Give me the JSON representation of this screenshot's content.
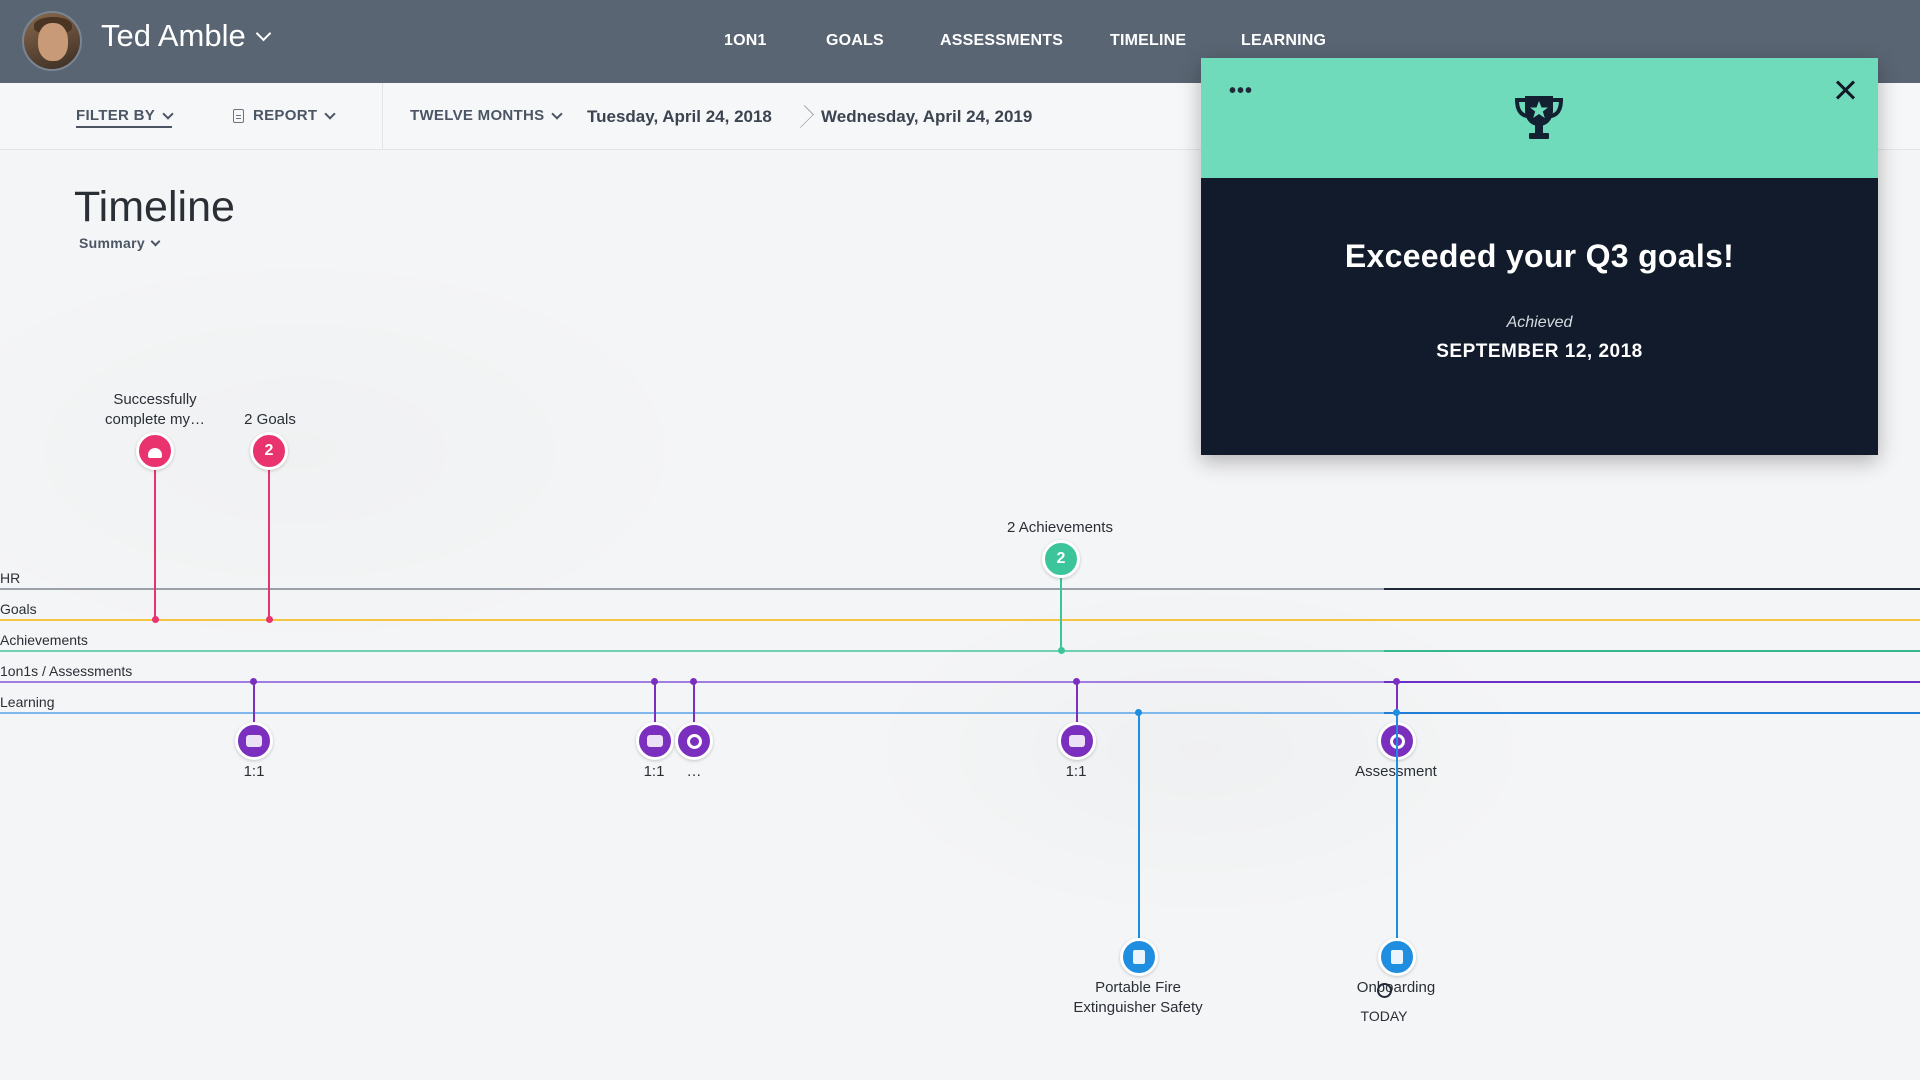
{
  "user": {
    "name": "Ted Amble"
  },
  "nav": {
    "items": [
      {
        "label": "1ON1"
      },
      {
        "label": "GOALS"
      },
      {
        "label": "ASSESSMENTS"
      },
      {
        "label": "TIMELINE"
      },
      {
        "label": "LEARNING"
      }
    ]
  },
  "filters": {
    "filter_by": "FILTER BY",
    "report": "REPORT",
    "range": "TWELVE MONTHS",
    "start_date": "Tuesday, April 24, 2018",
    "end_date": "Wednesday, April 24, 2019"
  },
  "page": {
    "title": "Timeline",
    "view": "Summary"
  },
  "lanes": [
    {
      "label": "HR",
      "color": "#4b5563"
    },
    {
      "label": "Goals",
      "color": "#f5c542"
    },
    {
      "label": "Achievements",
      "color": "#4fc3a1"
    },
    {
      "label": "1on1s / Assessments",
      "color": "#8a5cd6"
    },
    {
      "label": "Learning",
      "color": "#4a9be0"
    }
  ],
  "events": {
    "goal_single": {
      "label_line1": "Successfully",
      "label_line2": "complete my…",
      "icon": "user-icon",
      "color": "#e8336f"
    },
    "goals_group": {
      "label": "2 Goals",
      "count": "2",
      "color": "#e8336f"
    },
    "achievements_group": {
      "label": "2 Achievements",
      "count": "2",
      "color": "#3cc49b"
    },
    "oneonone_1": {
      "label": "1:1",
      "icon": "chat-icon",
      "color": "#7b2fbe"
    },
    "oneonone_2": {
      "label": "1:1",
      "icon": "chat-icon",
      "color": "#7b2fbe"
    },
    "assessment_more": {
      "label": "…",
      "icon": "cog-icon",
      "color": "#7b2fbe"
    },
    "oneonone_3": {
      "label": "1:1",
      "icon": "chat-icon",
      "color": "#7b2fbe"
    },
    "assessment": {
      "label": "Assessment",
      "icon": "cog-icon",
      "color": "#7b2fbe"
    },
    "learning_fire": {
      "label_line1": "Portable Fire",
      "label_line2": "Extinguisher Safety",
      "icon": "book-icon",
      "color": "#1f8ee0"
    },
    "learning_onboarding": {
      "label": "Onboarding",
      "icon": "book-icon",
      "color": "#1f8ee0"
    }
  },
  "today_label": "TODAY",
  "popup": {
    "menu_label": "•••",
    "title": "Exceeded your Q3 goals!",
    "status": "Achieved",
    "date": "SEPTEMBER 12, 2018",
    "accent": "#6fdbba",
    "icon": "trophy-icon"
  }
}
